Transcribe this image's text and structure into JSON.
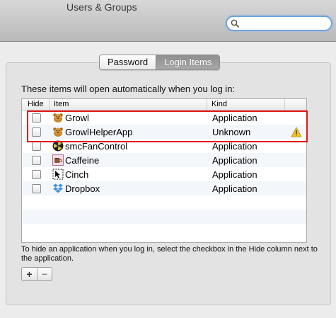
{
  "window": {
    "title": "Users & Groups"
  },
  "search": {
    "placeholder": "",
    "value": ""
  },
  "tabs": [
    {
      "label": "Password",
      "selected": false
    },
    {
      "label": "Login Items",
      "selected": true
    }
  ],
  "intro_text": "These items will open automatically when you log in:",
  "table": {
    "columns": {
      "hide": "Hide",
      "item": "Item",
      "kind": "Kind"
    },
    "rows": [
      {
        "name": "Growl",
        "kind": "Application",
        "icon": "growl-icon",
        "hide": false,
        "warning": false
      },
      {
        "name": "GrowlHelperApp",
        "kind": "Unknown",
        "icon": "growl-icon",
        "hide": false,
        "warning": true
      },
      {
        "name": "smcFanControl",
        "kind": "Application",
        "icon": "fan-icon",
        "hide": false,
        "warning": false
      },
      {
        "name": "Caffeine",
        "kind": "Application",
        "icon": "caffeine-icon",
        "hide": false,
        "warning": false
      },
      {
        "name": "Cinch",
        "kind": "Application",
        "icon": "cinch-icon",
        "hide": false,
        "warning": false
      },
      {
        "name": "Dropbox",
        "kind": "Application",
        "icon": "dropbox-icon",
        "hide": false,
        "warning": false
      }
    ]
  },
  "hint_text": "To hide an application when you log in, select the checkbox in the Hide column next to the application.",
  "buttons": {
    "add": "+",
    "remove": "−"
  },
  "colors": {
    "highlight": "#e01818",
    "focus_ring": "#6ea4e0"
  }
}
